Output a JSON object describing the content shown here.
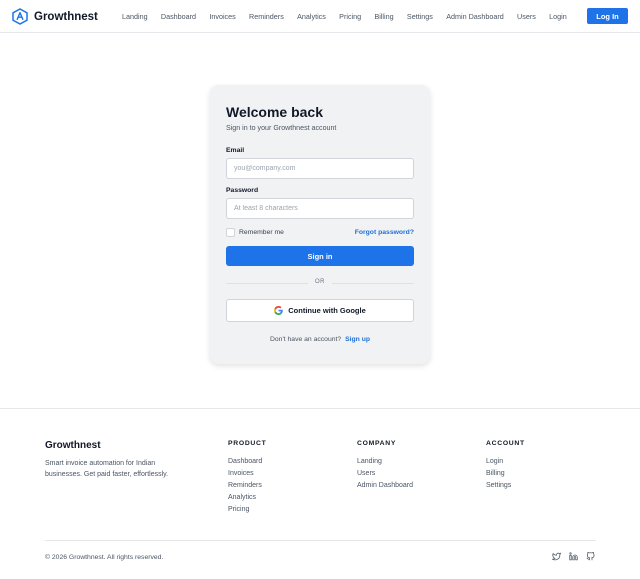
{
  "header": {
    "brand": "Growthnest",
    "nav": [
      "Landing",
      "Dashboard",
      "Invoices",
      "Reminders",
      "Analytics",
      "Pricing",
      "Billing",
      "Settings",
      "Admin Dashboard",
      "Users",
      "Login"
    ],
    "login_button": "Log In"
  },
  "login_card": {
    "title": "Welcome back",
    "subtitle": "Sign in to your Growthnest account",
    "email_label": "Email",
    "email_placeholder": "you@company.com",
    "email_value": "",
    "password_label": "Password",
    "password_placeholder": "At least 8 characters",
    "password_value": "",
    "remember_label": "Remember me",
    "remember_checked": false,
    "forgot_link": "Forgot password?",
    "signin_button": "Sign in",
    "divider_text": "OR",
    "google_button": "Continue with Google",
    "signup_prompt": "Don't have an account?",
    "signup_link": "Sign up"
  },
  "footer": {
    "brand": "Growthnest",
    "tagline": "Smart invoice automation for Indian businesses. Get paid faster, effortlessly.",
    "columns": [
      {
        "heading": "PRODUCT",
        "links": [
          "Dashboard",
          "Invoices",
          "Reminders",
          "Analytics",
          "Pricing"
        ]
      },
      {
        "heading": "COMPANY",
        "links": [
          "Landing",
          "Users",
          "Admin Dashboard"
        ]
      },
      {
        "heading": "ACCOUNT",
        "links": [
          "Login",
          "Billing",
          "Settings"
        ]
      }
    ],
    "copyright": "© 2026 Growthnest. All rights reserved.",
    "social_icons": [
      "twitter-icon",
      "linkedin-icon",
      "github-icon"
    ]
  },
  "colors": {
    "primary": "#1e73e8",
    "link": "#1e6fd9",
    "card_bg": "#f1f2f4",
    "text_dark": "#111827",
    "text_muted": "#4b5563"
  }
}
